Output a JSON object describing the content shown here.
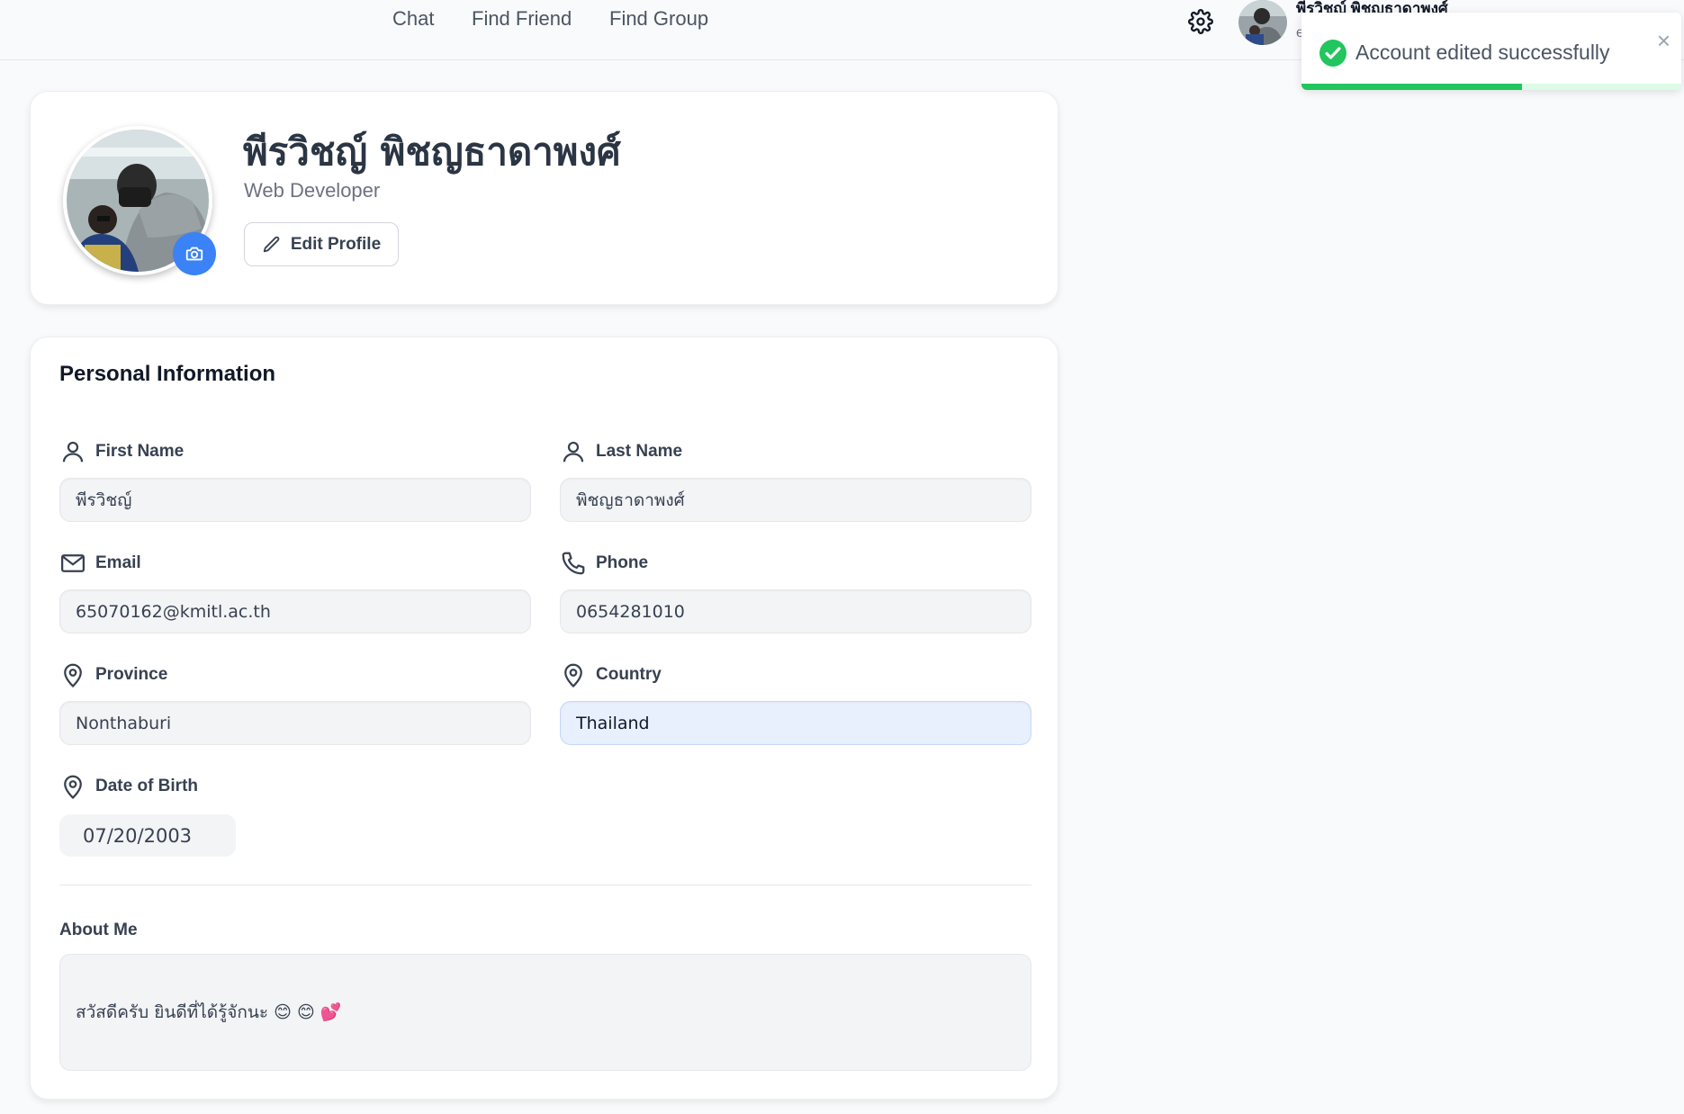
{
  "nav": {
    "links": [
      "Chat",
      "Find Friend",
      "Find Group"
    ],
    "user_name": "พีรวิชญ์ พิชญธาดาพงศ์",
    "user_sub": "e"
  },
  "toast": {
    "message": "Account edited successfully",
    "close_symbol": "×",
    "progress": 0.58
  },
  "profile": {
    "name": "พีรวิชญ์ พิชญธาดาพงศ์",
    "title": "Web Developer",
    "edit_label": "Edit Profile"
  },
  "personal_info": {
    "title": "Personal Information",
    "first_name_label": "First Name",
    "first_name": "พีรวิชญ์",
    "last_name_label": "Last Name",
    "last_name": "พิชญธาดาพงศ์",
    "email_label": "Email",
    "email": "65070162@kmitl.ac.th",
    "phone_label": "Phone",
    "phone": "0654281010",
    "province_label": "Province",
    "province": "Nonthaburi",
    "country_label": "Country",
    "country": "Thailand",
    "dob_label": "Date of Birth",
    "dob": "07/20/2003",
    "about_label": "About Me",
    "about": "สวัสดีครับ ยินดีที่ได้รู้จักนะ 😊 😊 💕"
  },
  "colors": {
    "accent": "#3b82f6",
    "success": "#22c55e",
    "active_field": "#e8f0fe"
  },
  "icons": [
    "settings-icon",
    "camera-icon",
    "pencil-icon",
    "user-icon",
    "mail-icon",
    "phone-icon",
    "map-pin-icon",
    "check-circle-icon",
    "close-icon"
  ]
}
